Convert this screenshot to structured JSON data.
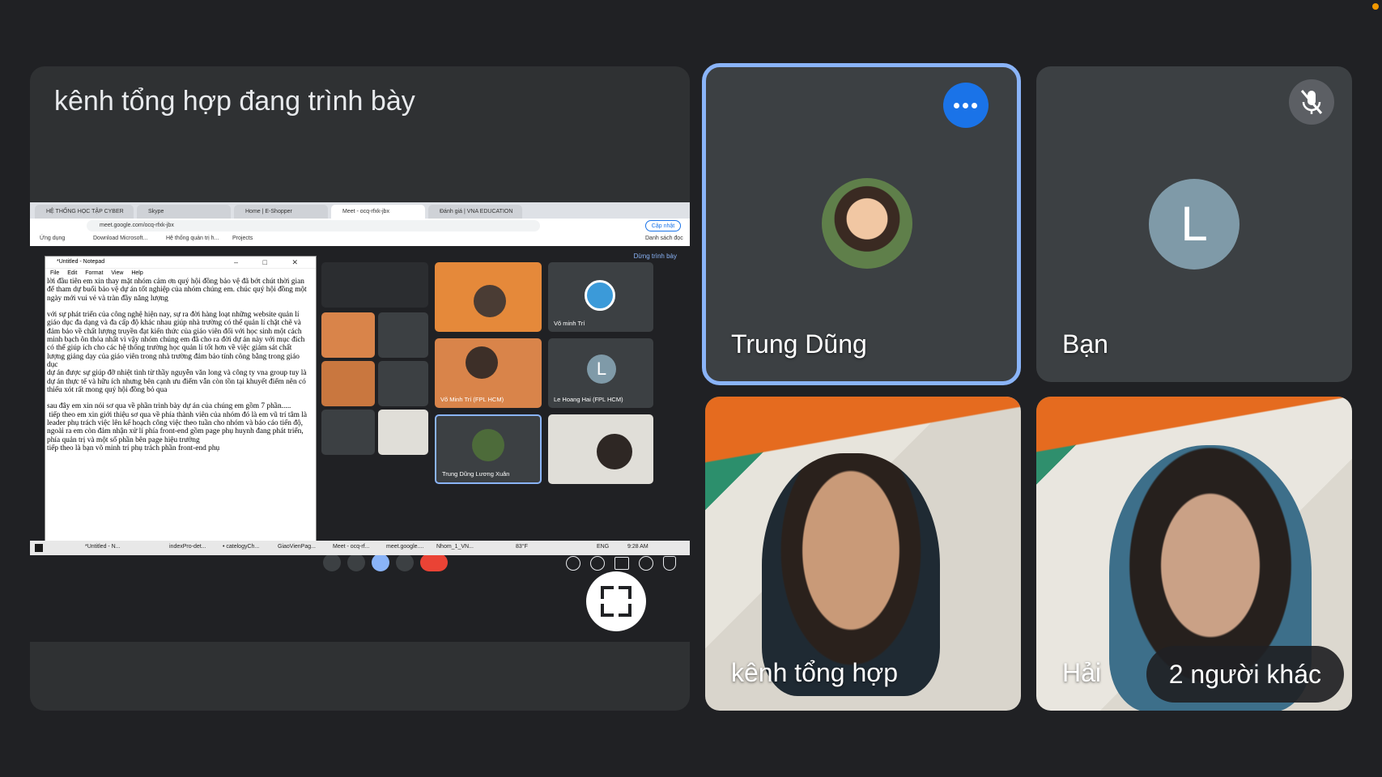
{
  "presentation": {
    "title": "kênh tổng hợp đang trình bày",
    "browser": {
      "tabs": [
        "HỆ THỐNG HỌC TẬP CYBER",
        "Skype",
        "Home | E-Shopper",
        "Meet - ocq-rfxk-jbx",
        "Đánh giá | VNA EDUCATION"
      ],
      "url": "meet.google.com/ocq-rfxk-jbx",
      "update_label": "Cập nhật",
      "bookmarks": [
        "Ứng dụng",
        "Download Microsoft...",
        "Hệ thống quản trị h...",
        "Projects"
      ],
      "reading_list": "Danh sách đọc"
    },
    "stop_presenting": "Dừng trình bày",
    "notepad": {
      "title": "*Untitled - Notepad",
      "menu": "File Edit Format View Help",
      "text": "lời đầu tiên em xin thay mặt nhóm cảm ơn quý hội đồng bảo vệ đã bớt chút thời gian để tham dự buổi bảo vệ dự án tốt nghiệp của nhóm chúng em. chúc quý hội đồng một ngày mới vui vẻ và tràn đầy năng lượng\n\nvới sự phát triển của công nghệ hiện nay, sự ra đời hàng loạt những website quản lí giáo dục đa dạng và đa cấp độ khác nhau giúp nhà trường có thể quản lí chặt chẽ và đảm bảo về chất lượng truyền đạt kiến thức của giáo viên đối với học sinh một cách minh bạch ôn thỏa nhất vì vậy nhóm chúng em đã cho ra đời dự án này với mục đích có thể giúp ích cho các hệ thống trường học quản lí tốt hơn về việc giám sát chất lượng giảng dạy của giáo viên trong nhà trường đảm bảo tính công bằng trong giáo dục\ndự án được sự giúp đỡ nhiệt tình từ thầy nguyễn văn long và công ty vna group tuy là dự án thực tế và hữu ích nhưng bên cạnh ưu điểm vẫn còn tồn tại khuyết điểm nên có thiếu xót rất mong quý hội đồng bỏ qua\n\nsau đây em xin nói sơ qua về phần trình bày dự án của chúng em gồm 7 phần.....\n tiếp theo em xin giới thiệu sơ qua về phía thành viên của nhóm đó là em vũ trí tâm là leader phụ trách việc lên kế hoạch công việc theo tuần cho nhóm và báo cáo tiến độ, ngoài ra em còn đảm nhận xử lí phía front-end gồm page phụ huynh đang phát triển, phía quản trị và một số phần bên page hiệu trưởng\ntiếp theo là bạn võ minh trí phụ trách phần front-end phụ"
    },
    "mini_tiles": [
      "Võ minh Trí",
      "Võ Minh Trí (FPL HCM)",
      "Le Hoang Hai (FPL HCM)",
      "Trung Dũng Lương Xuân"
    ],
    "mini_avatar_letter": "L",
    "taskbar": [
      "*Untitled - N...",
      "indexPro-det...",
      "• catelogyCh...",
      "GiaoVienPag...",
      "Meet - ocq-rf...",
      "meet.google....",
      "Nhom_1_VN...",
      "83°F",
      "ENG",
      "9:28 AM"
    ]
  },
  "participants": {
    "dung": {
      "name": "Trung Dũng"
    },
    "ban": {
      "name": "Bạn",
      "avatar_letter": "L"
    },
    "kenh": {
      "name": "kênh tổng hợp"
    },
    "hai": {
      "name": "Hải",
      "others": "2 người khác"
    }
  },
  "colors": {
    "background": "#202124",
    "tile": "#3c4043",
    "active_border": "#8ab4f8",
    "accent": "#1a73e8",
    "avatar_grey": "#7f9aa8",
    "end_call": "#ea4335"
  },
  "icons": [
    "more-icon",
    "mic-off-icon",
    "fullscreen-icon",
    "mic-icon",
    "camera-icon",
    "present-icon",
    "end-call-icon",
    "info-icon",
    "people-icon",
    "chat-icon",
    "activities-icon",
    "shield-icon"
  ]
}
